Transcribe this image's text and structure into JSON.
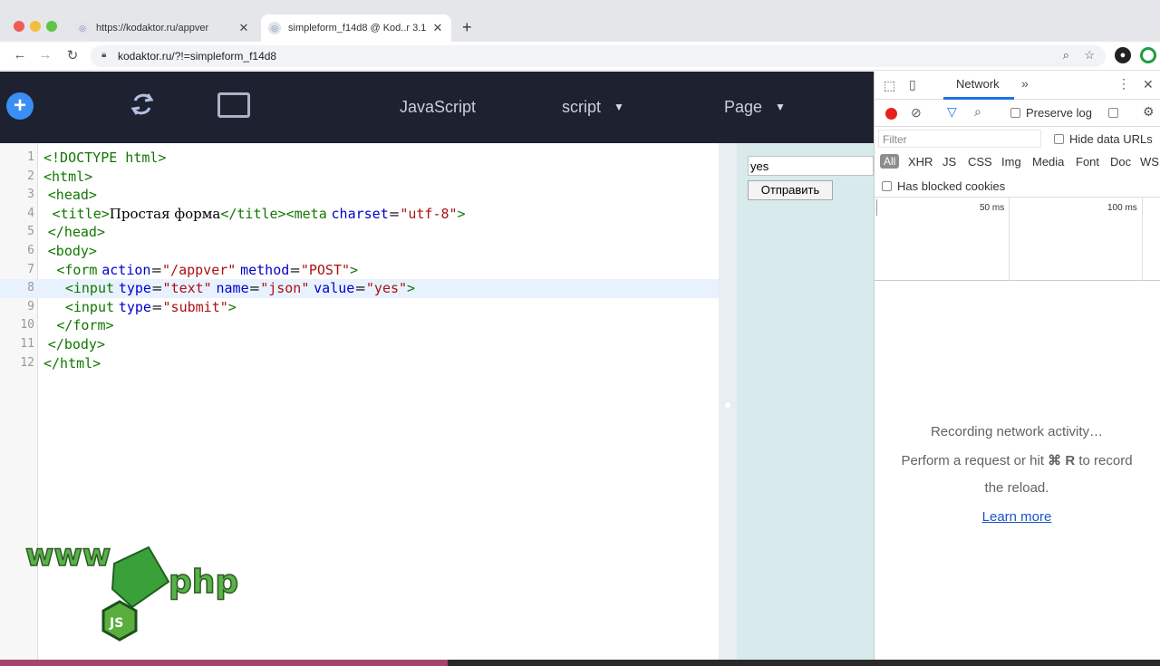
{
  "browser": {
    "tabs": [
      {
        "title": "https://kodaktor.ru/appver",
        "close": "✕"
      },
      {
        "title": "simpleform_f14d8 @ Kod..r 3.1",
        "close": "✕"
      }
    ],
    "new_tab": "+",
    "url": "kodaktor.ru/?!=simpleform_f14d8"
  },
  "app_header": {
    "plus": "+",
    "items": [
      "JavaScript",
      "script",
      "Page"
    ],
    "caret": "▼"
  },
  "editor": {
    "lines": [
      {
        "n": "1",
        "parts": [
          [
            "tg",
            "<!DOCTYPE html>"
          ]
        ]
      },
      {
        "n": "2",
        "parts": [
          [
            "tg",
            "<html>"
          ]
        ]
      },
      {
        "n": "3",
        "parts": [
          [
            "tx",
            " "
          ],
          [
            "tg",
            "<head>"
          ]
        ]
      },
      {
        "n": "4",
        "parts": [
          [
            "tx",
            "  "
          ],
          [
            "tg",
            "<title>"
          ],
          [
            "tx",
            "Простая форма"
          ],
          [
            "tg",
            "</title><meta"
          ],
          [
            "tx",
            " "
          ],
          [
            "at",
            "charset"
          ],
          [
            "tx",
            "="
          ],
          [
            "st",
            "\"utf-8\""
          ],
          [
            "tg",
            ">"
          ]
        ]
      },
      {
        "n": "5",
        "parts": [
          [
            "tx",
            " "
          ],
          [
            "tg",
            "</head>"
          ]
        ]
      },
      {
        "n": "6",
        "parts": [
          [
            "tx",
            " "
          ],
          [
            "tg",
            "<body>"
          ]
        ]
      },
      {
        "n": "7",
        "parts": [
          [
            "tx",
            "   "
          ],
          [
            "tg",
            "<form"
          ],
          [
            "tx",
            " "
          ],
          [
            "at",
            "action"
          ],
          [
            "tx",
            "="
          ],
          [
            "st",
            "\"/appver\""
          ],
          [
            "tx",
            " "
          ],
          [
            "at",
            "method"
          ],
          [
            "tx",
            "="
          ],
          [
            "st",
            "\"POST\""
          ],
          [
            "tg",
            ">"
          ]
        ]
      },
      {
        "n": "8",
        "parts": [
          [
            "tx",
            "     "
          ],
          [
            "tg",
            "<input"
          ],
          [
            "tx",
            " "
          ],
          [
            "at",
            "type"
          ],
          [
            "tx",
            "="
          ],
          [
            "st",
            "\"text\""
          ],
          [
            "tx",
            " "
          ],
          [
            "at",
            "name"
          ],
          [
            "tx",
            "="
          ],
          [
            "st",
            "\"json\""
          ],
          [
            "tx",
            " "
          ],
          [
            "at",
            "value"
          ],
          [
            "tx",
            "="
          ],
          [
            "st",
            "\"yes\""
          ],
          [
            "tg",
            ">"
          ]
        ]
      },
      {
        "n": "9",
        "parts": [
          [
            "tx",
            "     "
          ],
          [
            "tg",
            "<input"
          ],
          [
            "tx",
            " "
          ],
          [
            "at",
            "type"
          ],
          [
            "tx",
            "="
          ],
          [
            "st",
            "\"submit\""
          ],
          [
            "tg",
            ">"
          ]
        ]
      },
      {
        "n": "10",
        "parts": [
          [
            "tx",
            "   "
          ],
          [
            "tg",
            "</form>"
          ]
        ]
      },
      {
        "n": "11",
        "parts": [
          [
            "tx",
            " "
          ],
          [
            "tg",
            "</body>"
          ]
        ]
      },
      {
        "n": "12",
        "parts": [
          [
            "tg",
            "</html>"
          ]
        ]
      }
    ],
    "active_line": 8
  },
  "preview": {
    "input_value": "yes",
    "submit_label": "Отправить"
  },
  "devtools": {
    "network_tab": "Network",
    "more": "»",
    "menu": "⋮",
    "close": "✕",
    "preserve_log": "Preserve log",
    "filter_placeholder": "Filter",
    "hide_data_urls": "Hide data URLs",
    "types": [
      "All",
      "XHR",
      "JS",
      "CSS",
      "Img",
      "Media",
      "Font",
      "Doc",
      "WS"
    ],
    "has_blocked_cookies": "Has blocked cookies",
    "timeline_labels": [
      "50 ms",
      "100 ms"
    ],
    "empty_line1": "Recording network activity…",
    "empty_line2_a": "Perform a request or hit ",
    "empty_line2_key": "⌘ R",
    "empty_line2_b": " to record",
    "empty_line3": "the reload.",
    "learn_more": "Learn more"
  },
  "logo": {
    "www": "www",
    "php": "php",
    "js": "JS"
  },
  "colors": {
    "app_header": "#1e2130",
    "preview_bg": "#d9eaec",
    "tag": "#117700",
    "attr": "#0000cc",
    "string": "#aa1111"
  }
}
